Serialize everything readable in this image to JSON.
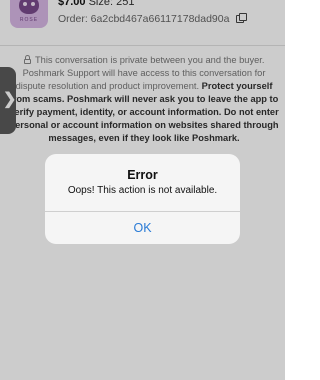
{
  "header": {
    "thumb_text": "ROSE",
    "price": "$7.00",
    "size": "Size: 251",
    "order": "Order: 6a2cbd467a66117178dad90a",
    "copy_icon": "copy-icon"
  },
  "notice": {
    "lock_icon": "lock-icon",
    "plain": "This conversation is private between you and the buyer. Poshmark Support will have access to this conversation for dispute resolution and product improvement.",
    "bold": "Protect yourself from scams. Poshmark will never ask you to leave the app to verify payment, identity, or account information. Do not enter personal or account information on websites shared through messages, even if they look like Poshmark."
  },
  "side_tab": {
    "chevron": "❯",
    "icon": "chevron-right-icon"
  },
  "alert": {
    "title": "Error",
    "message": "Oops! This action is not available.",
    "ok_label": "OK",
    "ok_color": "#2a7bd6"
  }
}
